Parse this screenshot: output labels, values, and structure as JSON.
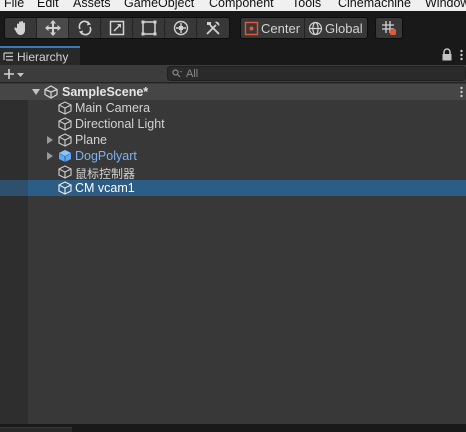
{
  "menu": [
    "File",
    "Edit",
    "Assets",
    "GameObject",
    "Component",
    "Tools",
    "Cinemachine",
    "Window"
  ],
  "toolbar": {
    "tools": [
      {
        "name": "hand-tool",
        "icon": "hand-icon",
        "active": false
      },
      {
        "name": "move-tool",
        "icon": "move-icon",
        "active": true
      },
      {
        "name": "rotate-tool",
        "icon": "rotate-icon",
        "active": false
      },
      {
        "name": "scale-tool",
        "icon": "scale-icon",
        "active": false
      },
      {
        "name": "rect-tool",
        "icon": "rect-icon",
        "active": false
      },
      {
        "name": "transform-tool",
        "icon": "transform-icon",
        "active": false
      },
      {
        "name": "custom-tool",
        "icon": "tools-icon",
        "active": false
      }
    ],
    "pivot_mode": "Center",
    "pivot_rotation": "Global",
    "snap_icon": "grid-snap-icon"
  },
  "hierarchy": {
    "tab_label": "Hierarchy",
    "add_label": "+",
    "search_placeholder": "All",
    "scene": {
      "name": "SampleScene*",
      "expanded": true
    },
    "items": [
      {
        "label": "Main Camera",
        "has_children": false,
        "prefab": false,
        "selected": false
      },
      {
        "label": "Directional Light",
        "has_children": false,
        "prefab": false,
        "selected": false
      },
      {
        "label": "Plane",
        "has_children": true,
        "prefab": false,
        "selected": false
      },
      {
        "label": "DogPolyart",
        "has_children": true,
        "prefab": true,
        "selected": false
      },
      {
        "label": "鼠标控制器",
        "has_children": false,
        "prefab": false,
        "selected": false
      },
      {
        "label": "CM vcam1",
        "has_children": false,
        "prefab": false,
        "selected": true
      }
    ]
  },
  "colors": {
    "selection": "#2c5d87",
    "prefab_text": "#7cb2f4",
    "panel_bg": "#383838",
    "accent_tab": "#3a79bb"
  }
}
